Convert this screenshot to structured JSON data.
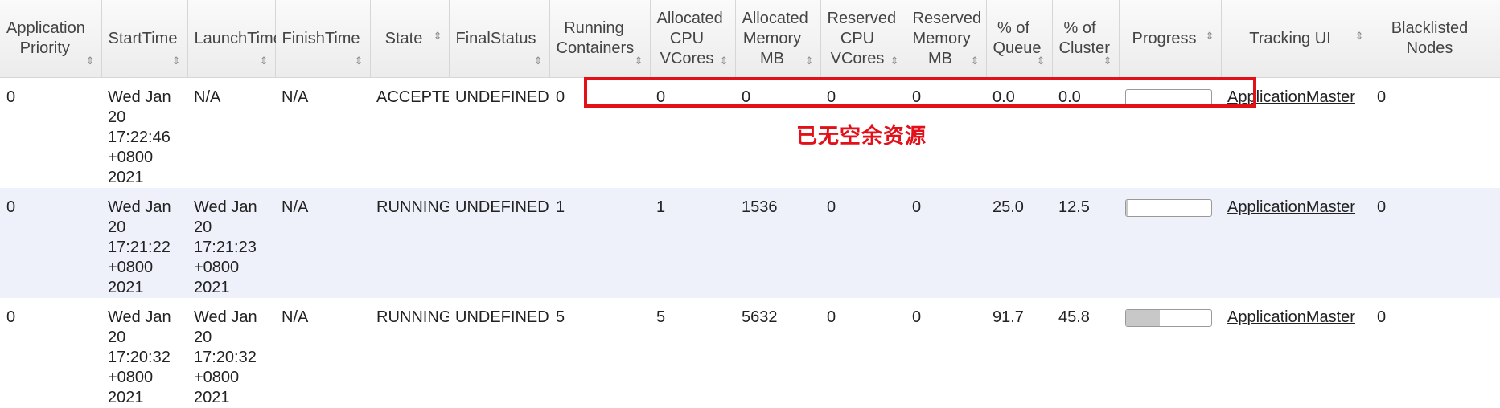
{
  "headers": [
    {
      "label": "Application Priority",
      "sort": "⇕"
    },
    {
      "label": "StartTime",
      "sort": "⇕"
    },
    {
      "label": "LaunchTime",
      "sort": "⇕"
    },
    {
      "label": "FinishTime",
      "sort": "⇕"
    },
    {
      "label": "State",
      "sort": "⇕"
    },
    {
      "label": "FinalStatus",
      "sort": "⇕"
    },
    {
      "label": "Running Containers",
      "sort": "⇕"
    },
    {
      "label": "Allocated CPU VCores",
      "sort": "⇕"
    },
    {
      "label": "Allocated Memory MB",
      "sort": "⇕"
    },
    {
      "label": "Reserved CPU VCores",
      "sort": "⇕"
    },
    {
      "label": "Reserved Memory MB",
      "sort": "⇕"
    },
    {
      "label": "% of Queue",
      "sort": "⇕"
    },
    {
      "label": "% of Cluster",
      "sort": "⇕"
    },
    {
      "label": "Progress",
      "sort": "⇕"
    },
    {
      "label": "Tracking UI",
      "sort": "⇕"
    },
    {
      "label": "Blacklisted Nodes",
      "sort": ""
    }
  ],
  "rows": [
    {
      "priority": "0",
      "start_time": "Wed Jan 20 17:22:46 +0800 2021",
      "launch_time": "N/A",
      "finish_time": "N/A",
      "state": "ACCEPTED",
      "final_status": "UNDEFINED",
      "running_containers": "0",
      "allocated_vcores": "0",
      "allocated_memory": "0",
      "reserved_vcores": "0",
      "reserved_memory": "0",
      "pct_queue": "0.0",
      "pct_cluster": "0.0",
      "progress": 0.0,
      "tracking_ui": "ApplicationMaster",
      "blacklisted_nodes": "0"
    },
    {
      "priority": "0",
      "start_time": "Wed Jan 20 17:21:22 +0800 2021",
      "launch_time": "Wed Jan 20 17:21:23 +0800 2021",
      "finish_time": "N/A",
      "state": "RUNNING",
      "final_status": "UNDEFINED",
      "running_containers": "1",
      "allocated_vcores": "1",
      "allocated_memory": "1536",
      "reserved_vcores": "0",
      "reserved_memory": "0",
      "pct_queue": "25.0",
      "pct_cluster": "12.5",
      "progress": 0.03,
      "tracking_ui": "ApplicationMaster",
      "blacklisted_nodes": "0"
    },
    {
      "priority": "0",
      "start_time": "Wed Jan 20 17:20:32 +0800 2021",
      "launch_time": "Wed Jan 20 17:20:32 +0800 2021",
      "finish_time": "N/A",
      "state": "RUNNING",
      "final_status": "UNDEFINED",
      "running_containers": "5",
      "allocated_vcores": "5",
      "allocated_memory": "5632",
      "reserved_vcores": "0",
      "reserved_memory": "0",
      "pct_queue": "91.7",
      "pct_cluster": "45.8",
      "progress": 0.4,
      "tracking_ui": "ApplicationMaster",
      "blacklisted_nodes": "0"
    }
  ],
  "annotation": {
    "text": "已无空余资源",
    "color": "#e3101a"
  }
}
